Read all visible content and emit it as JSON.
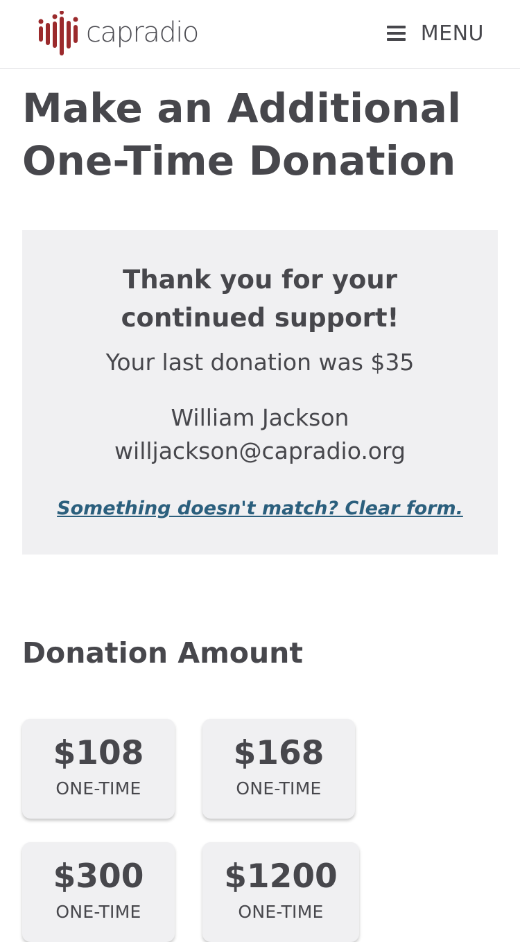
{
  "header": {
    "logo_text": "capradio",
    "menu_label": "MENU"
  },
  "page": {
    "title": "Make an Additional One-Time Donation"
  },
  "info_box": {
    "thanks": "Thank you for your continued support!",
    "last_donation": "Your last donation was $35",
    "donor_name": "William Jackson",
    "donor_email": "willjackson@capradio.org",
    "clear_link": "Something doesn't match? Clear form."
  },
  "donation": {
    "heading": "Donation Amount",
    "options": [
      {
        "amount": "$108",
        "frequency": "ONE-TIME"
      },
      {
        "amount": "$168",
        "frequency": "ONE-TIME"
      },
      {
        "amount": "$300",
        "frequency": "ONE-TIME"
      },
      {
        "amount": "$1200",
        "frequency": "ONE-TIME"
      }
    ]
  },
  "colors": {
    "brand_red": "#9b2a2c",
    "text": "#47474c",
    "link": "#2b5f7d",
    "panel_bg": "#f0f0f2"
  },
  "icons": [
    "capradio-logo-icon",
    "hamburger-menu-icon"
  ]
}
